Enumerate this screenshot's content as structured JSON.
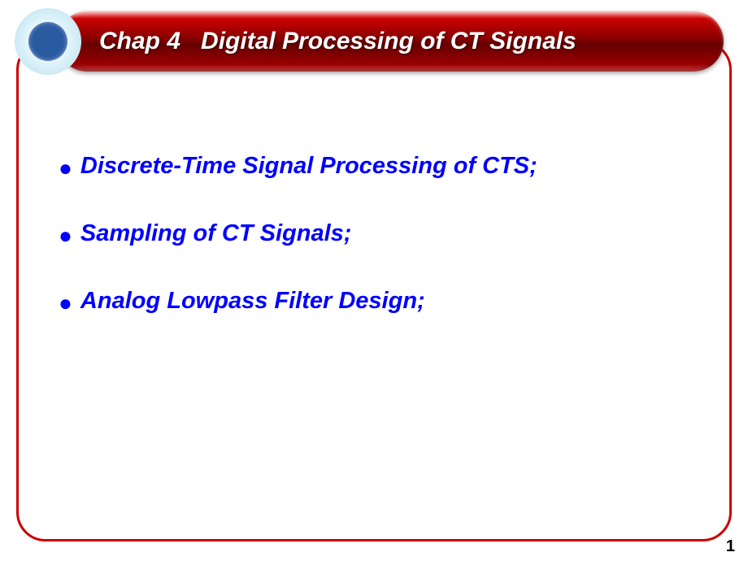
{
  "header": {
    "chapter": "Chap 4",
    "title": "Digital Processing of CT Signals"
  },
  "bullets": [
    "Discrete-Time Signal Processing of CTS;",
    "Sampling of CT Signals;",
    "Analog Lowpass Filter Design;"
  ],
  "page_number": "1"
}
